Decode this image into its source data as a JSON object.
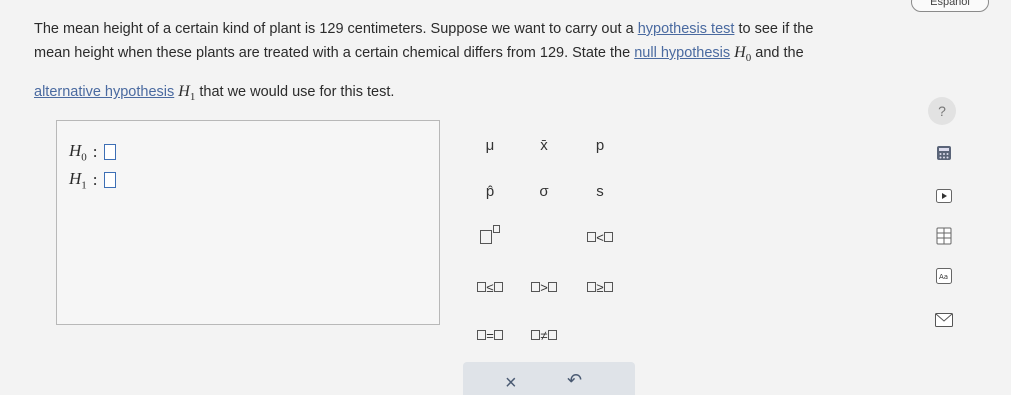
{
  "header": {
    "language_label": "Español"
  },
  "problem": {
    "line1_a": "The mean height of a certain kind of plant is 129 centimeters. Suppose we want to carry out a ",
    "link_hypothesis_test": "hypothesis test",
    "line1_b": " to see if the",
    "line2_a": "mean height when these plants are treated with a certain chemical differs from 129. State the ",
    "link_null_hypothesis": "null hypothesis",
    "h0_symbol": "H",
    "h0_sub": "0",
    "line2_b": " and the",
    "link_alternative_hypothesis": "alternative hypothesis",
    "h1_symbol": "H",
    "h1_sub": "1",
    "line3_b": " that we would use for this test."
  },
  "help": {
    "label": "?"
  },
  "answer": {
    "rows": [
      {
        "symbol": "H",
        "sub": "0",
        "colon": ":"
      },
      {
        "symbol": "H",
        "sub": "1",
        "colon": ":"
      }
    ]
  },
  "palette": {
    "mu": "μ",
    "xbar": "x̄",
    "p": "p",
    "phat": "p̂",
    "sigma": "σ",
    "s": "s",
    "lt": "<",
    "le": "≤",
    "gt": ">",
    "ge": "≥",
    "eq": "=",
    "ne": "≠"
  },
  "actions": {
    "clear": "×",
    "undo": "↶"
  },
  "side_icons": [
    "calculator-icon",
    "play-icon",
    "data-table-icon",
    "text-size-icon",
    "mail-icon"
  ]
}
